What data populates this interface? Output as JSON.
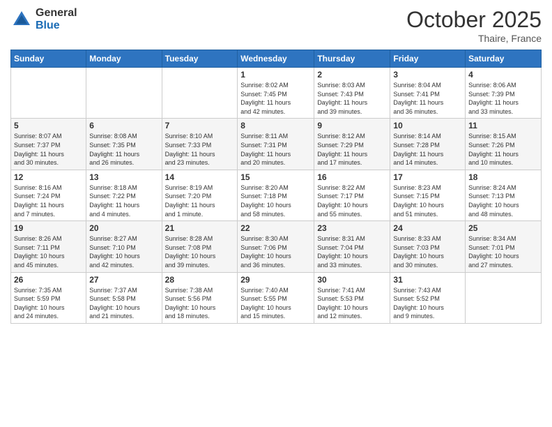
{
  "logo": {
    "general": "General",
    "blue": "Blue"
  },
  "header": {
    "month": "October 2025",
    "location": "Thaire, France"
  },
  "weekdays": [
    "Sunday",
    "Monday",
    "Tuesday",
    "Wednesday",
    "Thursday",
    "Friday",
    "Saturday"
  ],
  "weeks": [
    [
      {
        "day": "",
        "info": ""
      },
      {
        "day": "",
        "info": ""
      },
      {
        "day": "",
        "info": ""
      },
      {
        "day": "1",
        "info": "Sunrise: 8:02 AM\nSunset: 7:45 PM\nDaylight: 11 hours\nand 42 minutes."
      },
      {
        "day": "2",
        "info": "Sunrise: 8:03 AM\nSunset: 7:43 PM\nDaylight: 11 hours\nand 39 minutes."
      },
      {
        "day": "3",
        "info": "Sunrise: 8:04 AM\nSunset: 7:41 PM\nDaylight: 11 hours\nand 36 minutes."
      },
      {
        "day": "4",
        "info": "Sunrise: 8:06 AM\nSunset: 7:39 PM\nDaylight: 11 hours\nand 33 minutes."
      }
    ],
    [
      {
        "day": "5",
        "info": "Sunrise: 8:07 AM\nSunset: 7:37 PM\nDaylight: 11 hours\nand 30 minutes."
      },
      {
        "day": "6",
        "info": "Sunrise: 8:08 AM\nSunset: 7:35 PM\nDaylight: 11 hours\nand 26 minutes."
      },
      {
        "day": "7",
        "info": "Sunrise: 8:10 AM\nSunset: 7:33 PM\nDaylight: 11 hours\nand 23 minutes."
      },
      {
        "day": "8",
        "info": "Sunrise: 8:11 AM\nSunset: 7:31 PM\nDaylight: 11 hours\nand 20 minutes."
      },
      {
        "day": "9",
        "info": "Sunrise: 8:12 AM\nSunset: 7:29 PM\nDaylight: 11 hours\nand 17 minutes."
      },
      {
        "day": "10",
        "info": "Sunrise: 8:14 AM\nSunset: 7:28 PM\nDaylight: 11 hours\nand 14 minutes."
      },
      {
        "day": "11",
        "info": "Sunrise: 8:15 AM\nSunset: 7:26 PM\nDaylight: 11 hours\nand 10 minutes."
      }
    ],
    [
      {
        "day": "12",
        "info": "Sunrise: 8:16 AM\nSunset: 7:24 PM\nDaylight: 11 hours\nand 7 minutes."
      },
      {
        "day": "13",
        "info": "Sunrise: 8:18 AM\nSunset: 7:22 PM\nDaylight: 11 hours\nand 4 minutes."
      },
      {
        "day": "14",
        "info": "Sunrise: 8:19 AM\nSunset: 7:20 PM\nDaylight: 11 hours\nand 1 minute."
      },
      {
        "day": "15",
        "info": "Sunrise: 8:20 AM\nSunset: 7:18 PM\nDaylight: 10 hours\nand 58 minutes."
      },
      {
        "day": "16",
        "info": "Sunrise: 8:22 AM\nSunset: 7:17 PM\nDaylight: 10 hours\nand 55 minutes."
      },
      {
        "day": "17",
        "info": "Sunrise: 8:23 AM\nSunset: 7:15 PM\nDaylight: 10 hours\nand 51 minutes."
      },
      {
        "day": "18",
        "info": "Sunrise: 8:24 AM\nSunset: 7:13 PM\nDaylight: 10 hours\nand 48 minutes."
      }
    ],
    [
      {
        "day": "19",
        "info": "Sunrise: 8:26 AM\nSunset: 7:11 PM\nDaylight: 10 hours\nand 45 minutes."
      },
      {
        "day": "20",
        "info": "Sunrise: 8:27 AM\nSunset: 7:10 PM\nDaylight: 10 hours\nand 42 minutes."
      },
      {
        "day": "21",
        "info": "Sunrise: 8:28 AM\nSunset: 7:08 PM\nDaylight: 10 hours\nand 39 minutes."
      },
      {
        "day": "22",
        "info": "Sunrise: 8:30 AM\nSunset: 7:06 PM\nDaylight: 10 hours\nand 36 minutes."
      },
      {
        "day": "23",
        "info": "Sunrise: 8:31 AM\nSunset: 7:04 PM\nDaylight: 10 hours\nand 33 minutes."
      },
      {
        "day": "24",
        "info": "Sunrise: 8:33 AM\nSunset: 7:03 PM\nDaylight: 10 hours\nand 30 minutes."
      },
      {
        "day": "25",
        "info": "Sunrise: 8:34 AM\nSunset: 7:01 PM\nDaylight: 10 hours\nand 27 minutes."
      }
    ],
    [
      {
        "day": "26",
        "info": "Sunrise: 7:35 AM\nSunset: 5:59 PM\nDaylight: 10 hours\nand 24 minutes."
      },
      {
        "day": "27",
        "info": "Sunrise: 7:37 AM\nSunset: 5:58 PM\nDaylight: 10 hours\nand 21 minutes."
      },
      {
        "day": "28",
        "info": "Sunrise: 7:38 AM\nSunset: 5:56 PM\nDaylight: 10 hours\nand 18 minutes."
      },
      {
        "day": "29",
        "info": "Sunrise: 7:40 AM\nSunset: 5:55 PM\nDaylight: 10 hours\nand 15 minutes."
      },
      {
        "day": "30",
        "info": "Sunrise: 7:41 AM\nSunset: 5:53 PM\nDaylight: 10 hours\nand 12 minutes."
      },
      {
        "day": "31",
        "info": "Sunrise: 7:43 AM\nSunset: 5:52 PM\nDaylight: 10 hours\nand 9 minutes."
      },
      {
        "day": "",
        "info": ""
      }
    ]
  ]
}
